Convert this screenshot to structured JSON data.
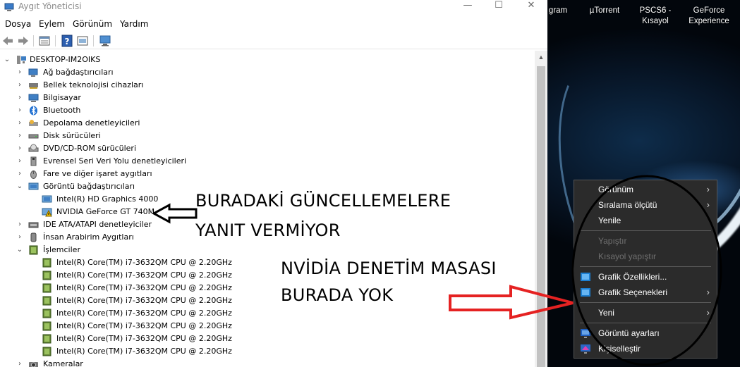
{
  "window": {
    "title": "Aygıt Yöneticisi",
    "controls": {
      "minimize": "—",
      "maximize": "☐",
      "close": "✕"
    }
  },
  "menubar": [
    "Dosya",
    "Eylem",
    "Görünüm",
    "Yardım"
  ],
  "toolbar": [
    "back-icon",
    "forward-icon",
    "properties-icon",
    "help-icon",
    "show-hidden-icon",
    "monitor-scan-icon"
  ],
  "tree": {
    "root": "DESKTOP-IM2OIKS",
    "categories": [
      {
        "label": "Ağ bağdaştırıcıları",
        "icon": "network-icon",
        "expanded": false
      },
      {
        "label": "Bellek teknolojisi cihazları",
        "icon": "memory-icon",
        "expanded": false
      },
      {
        "label": "Bilgisayar",
        "icon": "computer-icon",
        "expanded": false
      },
      {
        "label": "Bluetooth",
        "icon": "bluetooth-icon",
        "expanded": false
      },
      {
        "label": "Depolama denetleyicileri",
        "icon": "storage-icon",
        "expanded": false
      },
      {
        "label": "Disk sürücüleri",
        "icon": "disk-icon",
        "expanded": false
      },
      {
        "label": "DVD/CD-ROM sürücüleri",
        "icon": "dvd-icon",
        "expanded": false
      },
      {
        "label": "Evrensel Seri Veri Yolu denetleyicileri",
        "icon": "usb-icon",
        "expanded": false
      },
      {
        "label": "Fare ve diğer işaret aygıtları",
        "icon": "mouse-icon",
        "expanded": false
      },
      {
        "label": "Görüntü bağdaştırıcıları",
        "icon": "display-adapter-icon",
        "expanded": true,
        "children": [
          {
            "label": "Intel(R) HD Graphics 4000",
            "icon": "display-adapter-icon",
            "warning": false
          },
          {
            "label": "NVIDIA GeForce GT 740M",
            "icon": "display-adapter-warning-icon",
            "warning": true
          }
        ]
      },
      {
        "label": "IDE ATA/ATAPI denetleyiciler",
        "icon": "ide-icon",
        "expanded": false
      },
      {
        "label": "İnsan Arabirim Aygıtları",
        "icon": "hid-icon",
        "expanded": false
      },
      {
        "label": "İşlemciler",
        "icon": "processor-icon",
        "expanded": true,
        "children_label": "Intel(R) Core(TM) i7-3632QM CPU @ 2.20GHz",
        "children_count": 8
      },
      {
        "label": "Kameralar",
        "icon": "camera-icon",
        "expanded": false
      }
    ]
  },
  "desktop_icons": [
    {
      "label": "gram"
    },
    {
      "label": "µTorrent"
    },
    {
      "label": "PSCS6 -\nKısayol"
    },
    {
      "label": "GeForce\nExperience"
    }
  ],
  "context_menu": {
    "items": [
      {
        "label": "Görünüm",
        "submenu": true,
        "disabled": false,
        "icon": ""
      },
      {
        "label": "Sıralama ölçütü",
        "submenu": true,
        "disabled": false,
        "icon": ""
      },
      {
        "label": "Yenile",
        "submenu": false,
        "disabled": false,
        "icon": ""
      },
      {
        "sep": true
      },
      {
        "label": "Yapıştır",
        "submenu": false,
        "disabled": true,
        "icon": ""
      },
      {
        "label": "Kısayol yapıştır",
        "submenu": false,
        "disabled": true,
        "icon": ""
      },
      {
        "sep": true
      },
      {
        "label": "Grafik Özellikleri...",
        "submenu": false,
        "disabled": false,
        "icon": "intel-graphics-icon"
      },
      {
        "label": "Grafik Seçenekleri",
        "submenu": true,
        "disabled": false,
        "icon": "intel-graphics-icon"
      },
      {
        "sep": true
      },
      {
        "label": "Yeni",
        "submenu": true,
        "disabled": false,
        "icon": ""
      },
      {
        "sep": true
      },
      {
        "label": "Görüntü ayarları",
        "submenu": false,
        "disabled": false,
        "icon": "display-settings-icon"
      },
      {
        "label": "Kişiselleştir",
        "submenu": false,
        "disabled": false,
        "icon": "personalize-icon"
      }
    ]
  },
  "annotations": {
    "line1": "BURADAKİ GÜNCELLEMELERE",
    "line2": "YANIT VERMİYOR",
    "line3": "NVİDİA DENETİM MASASI",
    "line4": "BURADA YOK"
  },
  "colors": {
    "annotation_black": "#000000",
    "annotation_red": "#e52222",
    "menu_bg": "#2b2b2b",
    "warning": "#f2c200"
  }
}
